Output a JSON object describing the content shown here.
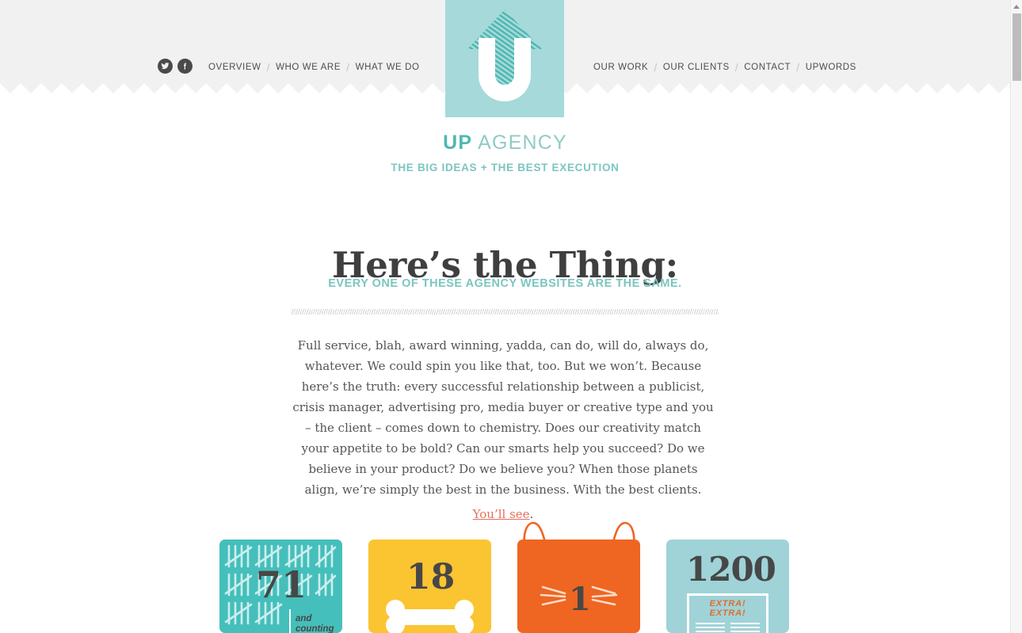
{
  "header": {
    "social": [
      {
        "name": "twitter-icon",
        "label": "Twitter"
      },
      {
        "name": "facebook-icon",
        "label": "Facebook"
      }
    ],
    "nav_left": [
      "OVERVIEW",
      "WHO WE ARE",
      "WHAT WE DO"
    ],
    "nav_right": [
      "OUR WORK",
      "OUR CLIENTS",
      "CONTACT",
      "UPWORDS"
    ],
    "separator": "/"
  },
  "logo": {
    "letter": "U",
    "alt": "up-arrow-logo"
  },
  "brand": {
    "name_bold": "UP",
    "name_light": " AGENCY",
    "tagline": "THE BIG IDEAS + THE BEST EXECUTION"
  },
  "main": {
    "headline": "Here’s the Thing:",
    "subhead": "EVERY ONE OF THESE AGENCY WEBSITES ARE THE SAME.",
    "body": "Full service, blah, award winning, yadda, can do, will do, always do, whatever. We could spin you like that, too. But we won’t. Because here’s the truth: every successful relationship between a publicist, crisis manager, advertising pro, media buyer or creative type and you – the client – comes down to chemistry. Does our creativity match your appetite to be bold? Can our smarts help you succeed? Do we believe in your product? Do we believe you? When those planets align, we’re simply the best in the business. With the best clients.",
    "link_text": "You’ll see",
    "link_tail": "."
  },
  "cards": [
    {
      "id": "tally-card",
      "number": "71",
      "caption_line1": "and",
      "caption_line2": "counting",
      "color": "#45bfbb",
      "icon": "tally-marks-icon"
    },
    {
      "id": "bone-card",
      "number": "18",
      "color": "#fbc431",
      "icon": "dog-bone-icon"
    },
    {
      "id": "cat-card",
      "number": "1",
      "color": "#ef6522",
      "icon": "cat-ears-whiskers-icon"
    },
    {
      "id": "newspaper-card",
      "number": "1200",
      "news_line1": "EXTRA!",
      "news_line2": "EXTRA!",
      "color": "#9fd3d8",
      "icon": "newspaper-icon"
    }
  ],
  "scrollbar": {
    "up_arrow": "scroll-up-arrow"
  },
  "colors": {
    "teal_dark": "#4fb8b2",
    "teal_light": "#90cbc6",
    "logo_bg": "#a5d9da",
    "header_bg": "#f1f1f1",
    "text_dark": "#3f3f3f",
    "body_text": "#555555",
    "link_orange": "#e4705a",
    "card_teal": "#45bfbb",
    "card_yellow": "#fbc431",
    "card_orange": "#ef6522",
    "card_lightteal": "#9fd3d8"
  }
}
